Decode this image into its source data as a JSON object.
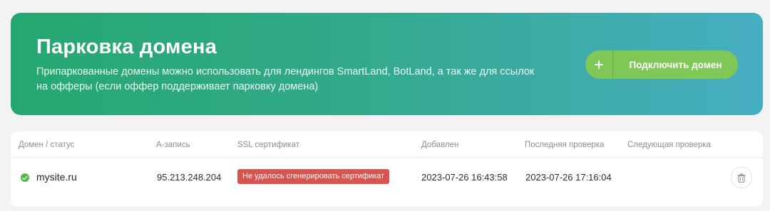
{
  "banner": {
    "title": "Парковка домена",
    "description": "Припаркованные домены можно использовать для лендингов SmartLand, BotLand, а так же для ссылок на офферы (если оффер поддерживает парковку домена)",
    "connect_button": {
      "icon": "plus-icon",
      "label": "Подключить домен"
    },
    "colors": {
      "gradient_start": "#25a870",
      "gradient_end": "#47aec2",
      "button": "#7fc756"
    }
  },
  "table": {
    "headers": {
      "domain_status": "Домен / статус",
      "a_record": "А-запись",
      "ssl": "SSL сертификат",
      "added": "Добавлен",
      "last_check": "Последняя проверка",
      "next_check": "Следующая проверка"
    },
    "rows": [
      {
        "status_icon": "check-circle-icon",
        "domain": "mysite.ru",
        "a_record": "95.213.248.204",
        "ssl_status": "Не удалось сгенерировать сертификат",
        "added": "2023-07-26 16:43:58",
        "last_check": "2023-07-26 17:16:04",
        "next_check": "",
        "action_icon": "trash-icon"
      }
    ],
    "colors": {
      "status_ok": "#52b845",
      "ssl_error": "#d9534f"
    }
  }
}
